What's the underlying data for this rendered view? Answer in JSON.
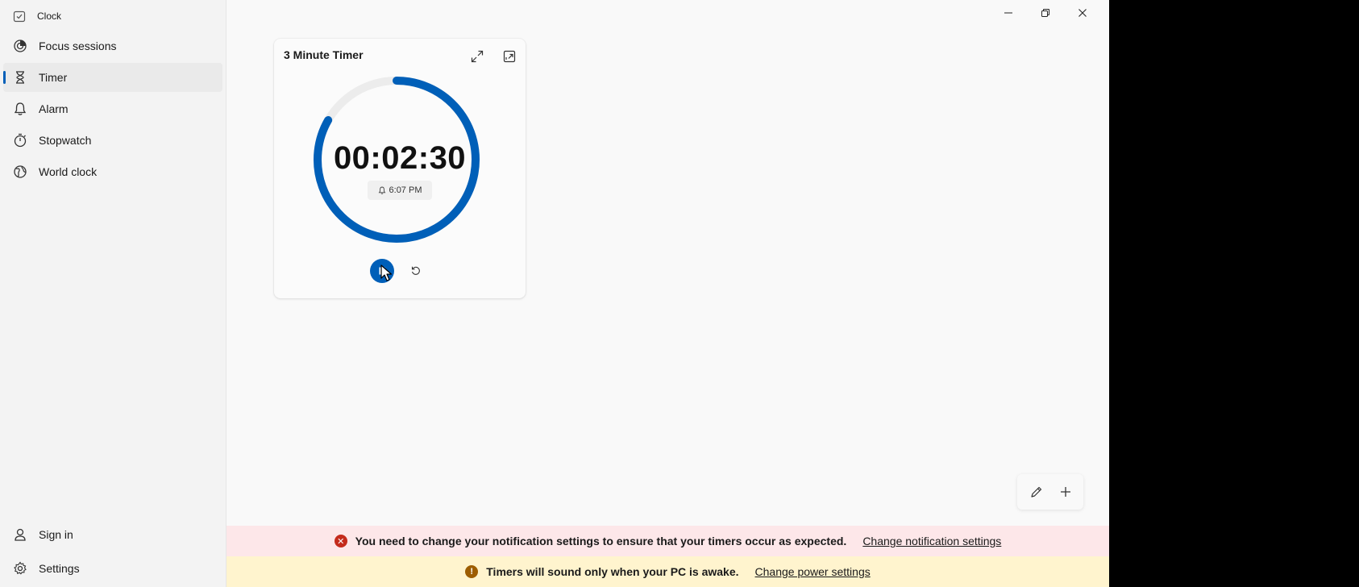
{
  "app": {
    "title": "Clock"
  },
  "sidebar": {
    "items": [
      {
        "label": "Focus sessions",
        "icon": "focus-icon"
      },
      {
        "label": "Timer",
        "icon": "hourglass-icon",
        "selected": true
      },
      {
        "label": "Alarm",
        "icon": "bell-icon"
      },
      {
        "label": "Stopwatch",
        "icon": "stopwatch-icon"
      },
      {
        "label": "World clock",
        "icon": "globe-icon"
      }
    ],
    "footer": [
      {
        "label": "Sign in",
        "icon": "person-icon"
      },
      {
        "label": "Settings",
        "icon": "gear-icon"
      }
    ]
  },
  "timer_card": {
    "title": "3 Minute Timer",
    "time": "00:02:30",
    "alarm_time": "6:07 PM",
    "progress_remaining": 0.8333,
    "accent": "#005fb8"
  },
  "notifications": {
    "error_text": "You need to change your notification settings to ensure that your timers occur as expected.",
    "error_link": "Change notification settings",
    "warning_text": "Timers will sound only when your PC is awake.",
    "warning_link": "Change power settings",
    "error_color": "#c42b1c",
    "warning_color": "#9d5d00"
  }
}
